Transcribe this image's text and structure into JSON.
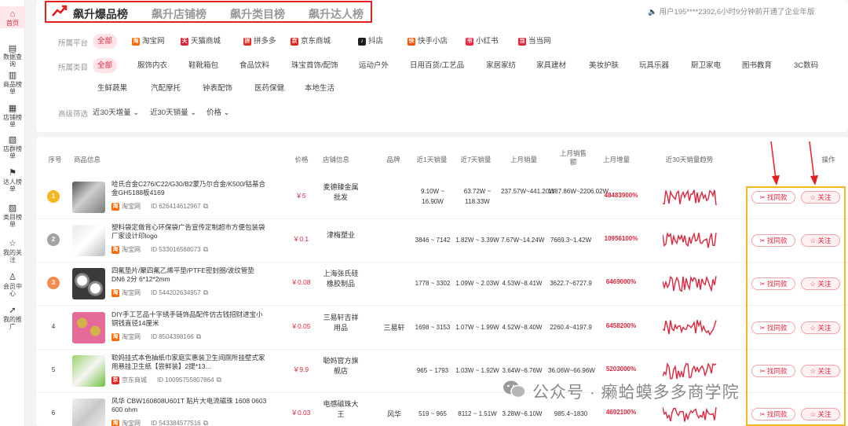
{
  "sidebar": {
    "items": [
      {
        "label": "首页",
        "icon": "home-icon",
        "glyph": "⌂"
      },
      {
        "label": "数据查询",
        "icon": "data-query-icon",
        "glyph": "▤"
      },
      {
        "label": "商品榜单",
        "icon": "product-list-icon",
        "glyph": "▥"
      },
      {
        "label": "店铺榜单",
        "icon": "shop-list-icon",
        "glyph": "▦"
      },
      {
        "label": "店群榜单",
        "icon": "shop-group-icon",
        "glyph": "▧"
      },
      {
        "label": "达人榜单",
        "icon": "influencer-icon",
        "glyph": "⚑"
      },
      {
        "label": "类目榜单",
        "icon": "category-icon",
        "glyph": "▨"
      },
      {
        "label": "我的关注",
        "icon": "star-icon",
        "glyph": "☆"
      },
      {
        "label": "会员中心",
        "icon": "member-icon",
        "glyph": "♙"
      },
      {
        "label": "我的推广",
        "icon": "share-icon",
        "glyph": "➚"
      }
    ]
  },
  "tabs": [
    "飙升爆品榜",
    "飙升店铺榜",
    "飙升类目榜",
    "飙升达人榜"
  ],
  "notice": "用户195****2392,6小时9分钟前开通了企业年版",
  "filters": {
    "platform_label": "所属平台",
    "platforms": [
      {
        "label": "全部",
        "color": ""
      },
      {
        "label": "淘宝网",
        "color": "#ff6a00",
        "glyph": "淘"
      },
      {
        "label": "天猫商城",
        "color": "#e0243c",
        "glyph": "天"
      },
      {
        "label": "拼多多",
        "color": "#e02e24",
        "glyph": "拼"
      },
      {
        "label": "京东商城",
        "color": "#e1251b",
        "glyph": "京"
      },
      {
        "label": "抖店",
        "color": "#1f1f1f",
        "glyph": "♪"
      },
      {
        "label": "快手小店",
        "color": "#ff5000",
        "glyph": "快"
      },
      {
        "label": "小红书",
        "color": "#ff2442",
        "glyph": "书"
      },
      {
        "label": "当当网",
        "color": "#e0243c",
        "glyph": "当"
      }
    ],
    "category_label": "所属类目",
    "categories": [
      "全部",
      "服饰内衣",
      "鞋靴箱包",
      "食品饮料",
      "珠宝首饰/配饰",
      "运动户外",
      "日用百货/工艺品",
      "家居家纺",
      "家具建材",
      "美妆护肤",
      "玩具乐器",
      "厨卫家电",
      "图书教育",
      "3C数码",
      "生鲜蔬果",
      "汽配摩托",
      "钟表配饰",
      "医药保健",
      "本地生活"
    ],
    "advanced_label": "高级筛选",
    "dropdowns": [
      "近30天增量",
      "近30天销量",
      "价格"
    ]
  },
  "table": {
    "headers": [
      "序号",
      "商品信息",
      "价格",
      "店铺信息",
      "品牌",
      "近1天销量",
      "近7天销量",
      "上月销量",
      "上月销售额",
      "上月增量",
      "近30天销量趋势",
      "操作"
    ],
    "find_label": "找同款",
    "follow_label": "关注",
    "rows": [
      {
        "rank": "1",
        "title": "哈氏合金C276/C22/G30/B2蒙乃尔合金/K500/钴基合金GH5188板4169",
        "platform": "淘宝网",
        "id": "ID 626414612967",
        "price": "￥5",
        "shop": "麦德臻金属批发",
        "brand": "",
        "d1": "9.10W ~ 16.90W",
        "d7": "63.72W ~ 118.33W",
        "lm": "237.57W~441.20W",
        "lms": "1187.86W~2206.02W",
        "inc": "48483900%"
      },
      {
        "rank": "2",
        "title": "塑料袋定做背心环保袋广告宣传定制超市方便包装袋厂家设计印logo",
        "platform": "淘宝网",
        "id": "ID 533016568073",
        "price": "￥0.1",
        "shop": "津梅塑业",
        "brand": "",
        "d1": "3846 ~ 7142",
        "d7": "1.82W ~ 3.39W",
        "lm": "7.67W~14.24W",
        "lms": "7669.3~1.42W",
        "inc": "10956100%"
      },
      {
        "rank": "3",
        "title": "四氟垫片/聚四氟乙烯平垫/PTFE密封圈/波纹管垫 DN6 2分 6*12*2mm",
        "platform": "淘宝网",
        "id": "ID 544202634957",
        "price": "￥0.08",
        "shop": "上海张氏硅橡胶制品",
        "brand": "",
        "d1": "1778 ~ 3302",
        "d7": "1.09W ~ 2.03W",
        "lm": "4.53W~8.41W",
        "lms": "3622.7~6727.9",
        "inc": "6469000%"
      },
      {
        "rank": "4",
        "title": "DIY手工艺品十字绣手链饰品配件仿古钱招财进宝小铜钱直径14厘米",
        "platform": "淘宝网",
        "id": "ID 8504398166",
        "price": "￥0.05",
        "shop": "三易轩吉祥用品",
        "brand": "三易轩",
        "d1": "1698 ~ 3153",
        "d7": "1.07W ~ 1.99W",
        "lm": "4.52W~8.40W",
        "lms": "2260.4~4197.9",
        "inc": "6458200%"
      },
      {
        "rank": "5",
        "title": "聪妈挂式本色抽纸巾家庭实惠装卫生间厕所挂壁式家用悬挂卫生纸【尝鲜装】2提*13...",
        "platform": "京东商城",
        "id": "ID 10095755807864",
        "price": "￥9.9",
        "shop": "聪妈官方旗舰店",
        "brand": "",
        "d1": "965 ~ 1793",
        "d7": "1.03W ~ 1.92W",
        "lm": "3.64W~6.76W",
        "lms": "36.06W~66.96W",
        "inc": "5203000%"
      },
      {
        "rank": "6",
        "title": "风华 CBW160808U601T 贴片大电流磁珠 1608 0603 600 ohm",
        "platform": "淘宝网",
        "id": "ID 543384577516",
        "price": "￥0.03",
        "shop": "电感磁珠大王",
        "brand": "风华",
        "d1": "519 ~ 965",
        "d7": "8112 ~ 1.51W",
        "lm": "3.28W~6.10W",
        "lms": "985.4~1830",
        "inc": "4692100%"
      }
    ]
  },
  "watermark": "公众号 · 癞蛤蟆多多商学院",
  "colors": {
    "accent": "#e0243c",
    "highlight_box": "#f5b622",
    "tab_box": "#e32020"
  }
}
